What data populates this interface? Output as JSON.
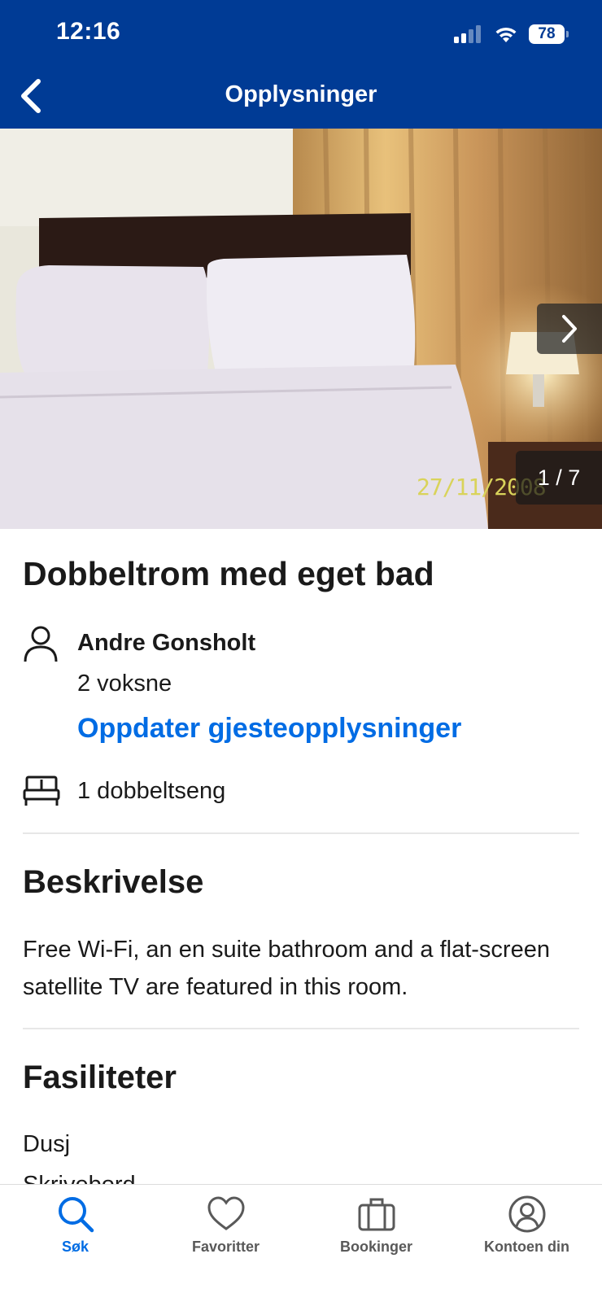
{
  "status_bar": {
    "time": "12:16",
    "battery": "78"
  },
  "header": {
    "title": "Opplysninger"
  },
  "gallery": {
    "counter": "1 / 7",
    "photo_date": "27/11/2008"
  },
  "room": {
    "title": "Dobbeltrom med eget bad",
    "guest_name": "Andre Gonsholt",
    "guest_count": "2 voksne",
    "update_link": "Oppdater gjesteopplysninger",
    "bed": "1 dobbeltseng"
  },
  "description": {
    "heading": "Beskrivelse",
    "text": "Free Wi-Fi, an en suite bathroom and a flat-screen satellite TV are featured in this room."
  },
  "facilities": {
    "heading": "Fasiliteter",
    "items": [
      "Dusj",
      "Skrivebord"
    ]
  },
  "tabbar": {
    "tabs": [
      {
        "label": "Søk",
        "icon": "search-icon",
        "active": true
      },
      {
        "label": "Favoritter",
        "icon": "heart-icon"
      },
      {
        "label": "Bookinger",
        "icon": "suitcase-icon"
      },
      {
        "label": "Kontoen din",
        "icon": "account-icon"
      }
    ]
  },
  "colors": {
    "brand": "#003b95",
    "link": "#006ce4",
    "text": "#1a1a1a"
  }
}
